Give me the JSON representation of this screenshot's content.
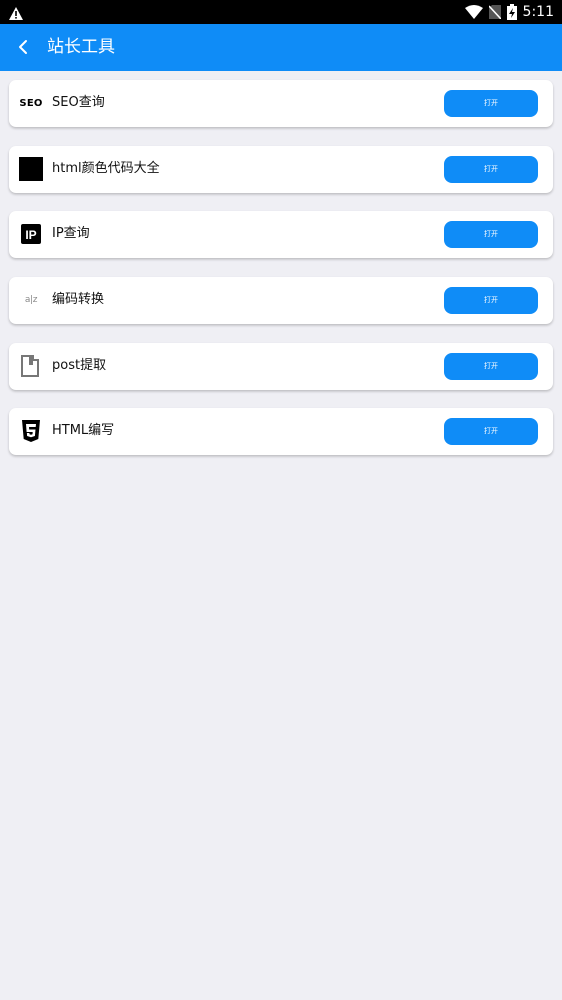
{
  "status_bar": {
    "time": "5:11",
    "icons": [
      "warning-icon",
      "wifi-icon",
      "no-sim-icon",
      "battery-charging-icon"
    ]
  },
  "app_bar": {
    "title": "站长工具",
    "back_icon": "chevron-left-icon"
  },
  "tools": [
    {
      "label": "SEO查询",
      "icon": "seo-icon",
      "icon_text": "SEO",
      "button": "打开"
    },
    {
      "label": "html颜色代码大全",
      "icon": "black-square-icon",
      "button": "打开"
    },
    {
      "label": "IP查询",
      "icon": "ip-icon",
      "icon_text": "IP",
      "button": "打开"
    },
    {
      "label": "编码转换",
      "icon": "encoding-icon",
      "icon_text": "a|z",
      "button": "打开"
    },
    {
      "label": "post提取",
      "icon": "clipboard-icon",
      "button": "打开"
    },
    {
      "label": "HTML编写",
      "icon": "html5-icon",
      "button": "打开"
    }
  ],
  "colors": {
    "primary": "#0f8cf7",
    "background": "#efeff4",
    "card": "#ffffff"
  }
}
